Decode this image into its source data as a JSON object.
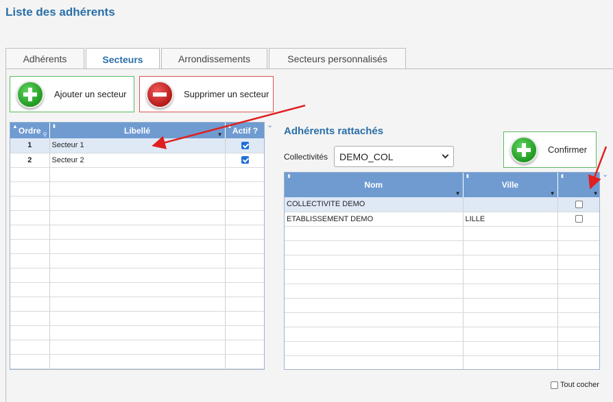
{
  "page": {
    "title": "Liste des adhérents"
  },
  "tabs": [
    {
      "label": "Adhérents",
      "active": false
    },
    {
      "label": "Secteurs",
      "active": true
    },
    {
      "label": "Arrondissements",
      "active": false
    },
    {
      "label": "Secteurs personnalisés",
      "active": false
    }
  ],
  "actions": {
    "add_label": "Ajouter un secteur",
    "delete_label": "Supprimer un secteur",
    "confirm_label": "Confirmer"
  },
  "sectors_grid": {
    "columns": [
      "Ordre",
      "Libellé",
      "Actif ?"
    ],
    "rows": [
      {
        "order": "1",
        "label": "Secteur 1",
        "active": true
      },
      {
        "order": "2",
        "label": "Secteur 2",
        "active": true
      }
    ]
  },
  "members": {
    "title": "Adhérents rattachés",
    "collectivites_label": "Collectivités",
    "collectivite_value": "DEMO_COL",
    "columns": [
      "Nom",
      "Ville"
    ],
    "rows": [
      {
        "name": "COLLECTIVITE DEMO",
        "city": "",
        "checked": false
      },
      {
        "name": "ETABLISSEMENT DEMO",
        "city": "LILLE",
        "checked": false
      }
    ],
    "check_all_label": "Tout cocher"
  },
  "colors": {
    "accent": "#2a6fa8",
    "grid_header": "#6f9bd1",
    "add": "#5cb85c",
    "delete": "#d9534f",
    "annotation_arrow": "#e02020"
  }
}
